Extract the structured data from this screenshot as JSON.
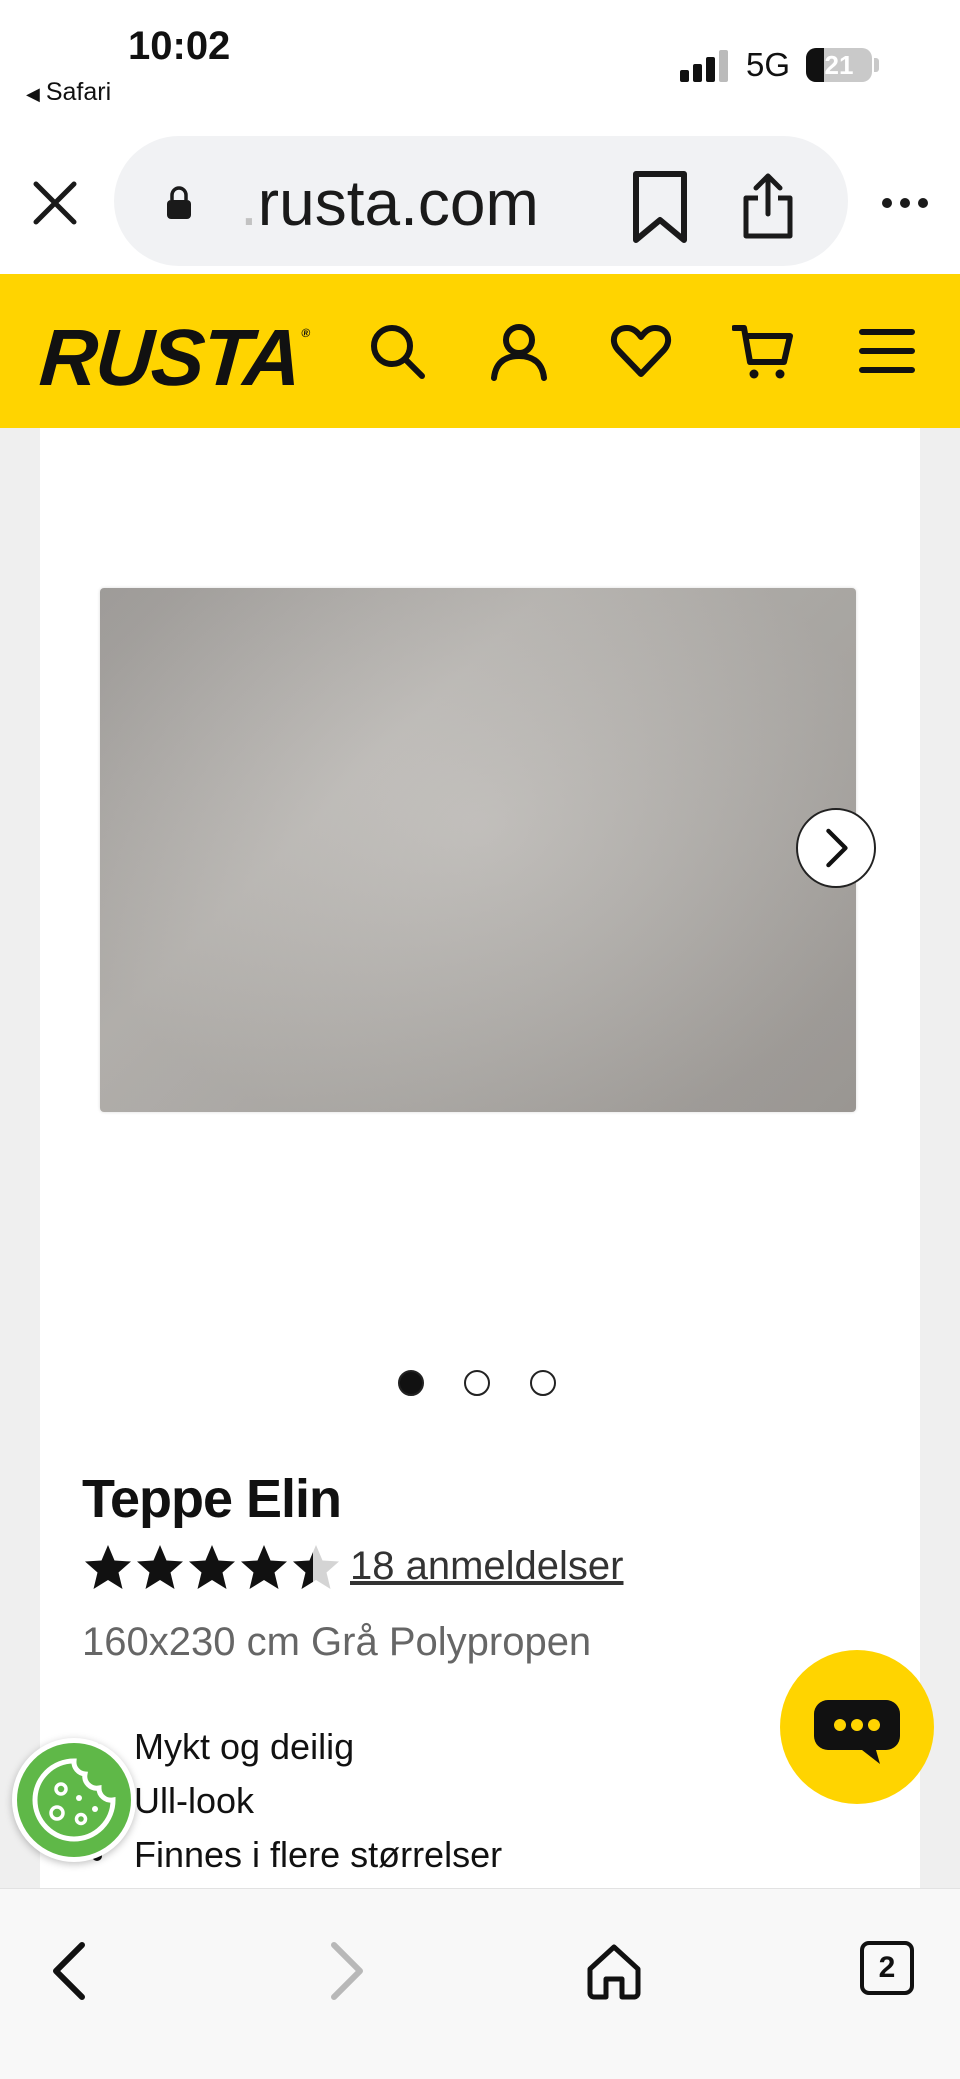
{
  "status_bar": {
    "time": "10:02",
    "back_app": "Safari",
    "network": "5G",
    "battery": "21",
    "battery_percent": 21
  },
  "browser": {
    "url_faded": ".",
    "url_main": "rusta.com",
    "tab_count": "2"
  },
  "site": {
    "logo": "RUSTA",
    "logo_mark": "®",
    "brand_color": "#ffd400",
    "header_icons": [
      "search-icon",
      "account-icon",
      "wishlist-icon",
      "cart-icon",
      "menu-icon"
    ]
  },
  "product": {
    "title": "Teppe Elin",
    "rating": 4.5,
    "rating_max": 5,
    "reviews_label": "18 anmeldelser",
    "variant": "160x230 cm Grå Polypropen",
    "image_color": "#b3b0ac",
    "gallery_total": 3,
    "gallery_active": 1,
    "features": [
      "Mykt og deilig",
      "Ull-look",
      "Finnes i flere størrelser"
    ]
  },
  "fabs": {
    "chat_color": "#ffd400",
    "cookie_color": "#5fb848"
  }
}
